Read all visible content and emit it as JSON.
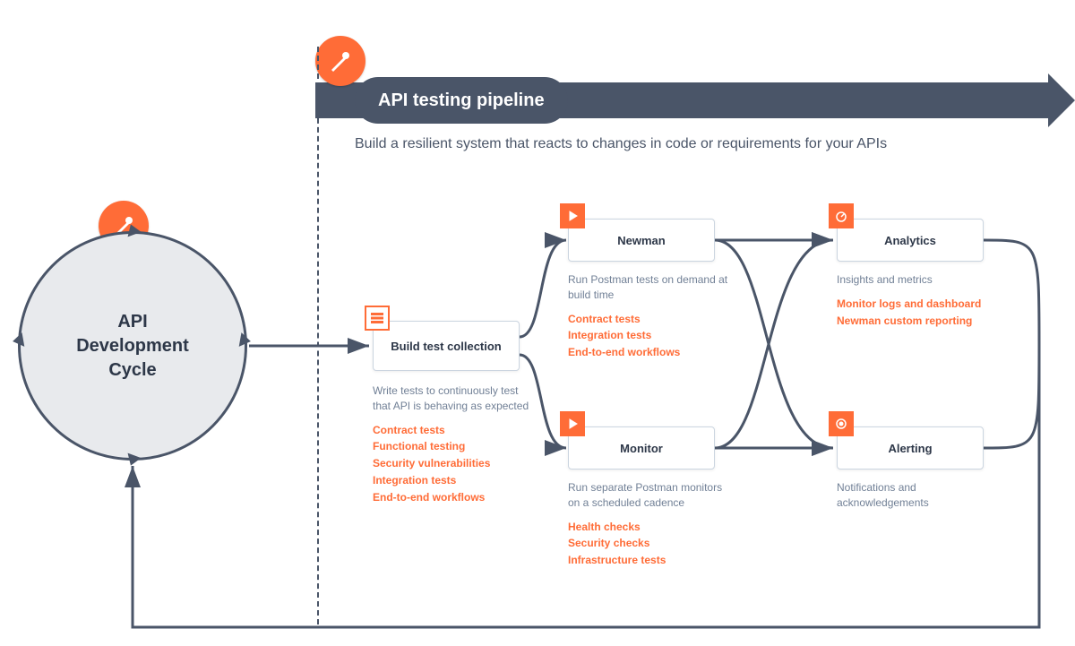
{
  "header": {
    "pill": "API testing pipeline",
    "subtitle": "Build a resilient system that reacts to changes in code or requirements for your APIs"
  },
  "cycle": {
    "line1": "API",
    "line2": "Development",
    "line3": "Cycle"
  },
  "nodes": {
    "build": {
      "title": "Build test collection"
    },
    "newman": {
      "title": "Newman"
    },
    "monitor": {
      "title": "Monitor"
    },
    "analytics": {
      "title": "Analytics"
    },
    "alerting": {
      "title": "Alerting"
    }
  },
  "desc": {
    "build": {
      "text": "Write tests to continuously test that API is behaving as expected",
      "items": [
        "Contract tests",
        "Functional testing",
        "Security vulnerabilities",
        "Integration tests",
        "End-to-end workflows"
      ]
    },
    "newman": {
      "text": "Run Postman tests on demand at build time",
      "items": [
        "Contract tests",
        "Integration tests",
        "End-to-end workflows"
      ]
    },
    "monitor": {
      "text": "Run separate Postman monitors on a scheduled cadence",
      "items": [
        "Health checks",
        "Security checks",
        "Infrastructure tests"
      ]
    },
    "analytics": {
      "text": "Insights and metrics",
      "items": [
        "Monitor logs and dashboard",
        "Newman custom reporting"
      ]
    },
    "alerting": {
      "text": "Notifications and acknowledgements",
      "items": []
    }
  },
  "colors": {
    "accent": "#FF6C37",
    "slate": "#4A5568"
  }
}
